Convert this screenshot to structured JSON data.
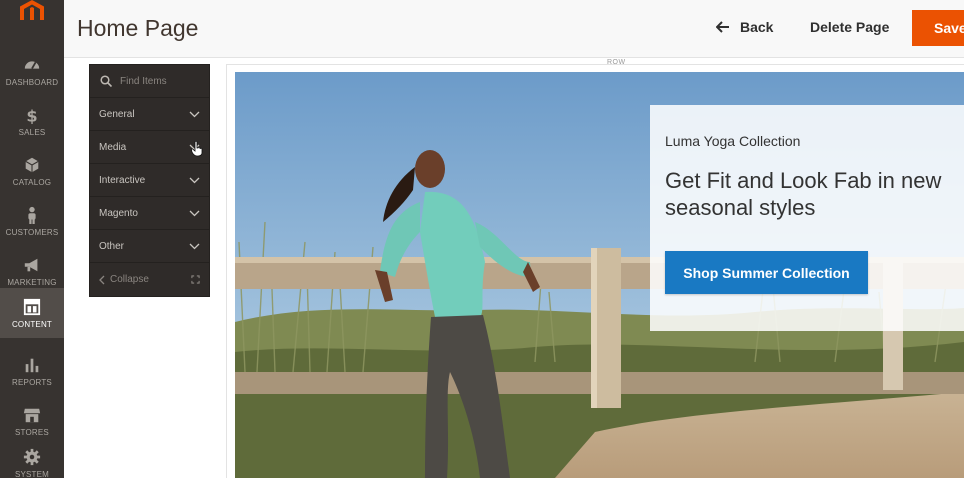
{
  "header": {
    "title": "Home Page",
    "back_label": "Back",
    "delete_label": "Delete Page",
    "save_label": "Save"
  },
  "admin_nav": {
    "items": [
      {
        "label": "DASHBOARD",
        "icon": "dashboard-icon"
      },
      {
        "label": "SALES",
        "icon": "dollar-icon"
      },
      {
        "label": "CATALOG",
        "icon": "cube-icon"
      },
      {
        "label": "CUSTOMERS",
        "icon": "person-icon"
      },
      {
        "label": "MARKETING",
        "icon": "megaphone-icon"
      },
      {
        "label": "CONTENT",
        "icon": "layout-icon",
        "active": true
      },
      {
        "label": "REPORTS",
        "icon": "bar-chart-icon"
      },
      {
        "label": "STORES",
        "icon": "store-icon"
      },
      {
        "label": "SYSTEM",
        "icon": "gear-icon"
      }
    ]
  },
  "panel": {
    "search_placeholder": "Find Items",
    "groups": [
      "General",
      "Media",
      "Interactive",
      "Magento",
      "Other"
    ],
    "collapse_label": "Collapse"
  },
  "stage": {
    "row_label": "ROW"
  },
  "banner": {
    "kicker": "Luma Yoga Collection",
    "headline": "Get Fit and Look Fab in new seasonal styles",
    "cta_label": "Shop Summer Collection"
  },
  "colors": {
    "nav_bg": "#373330",
    "accent_orange": "#eb5202",
    "cta_blue": "#1979c3",
    "panel_bg": "#2f2b29"
  }
}
